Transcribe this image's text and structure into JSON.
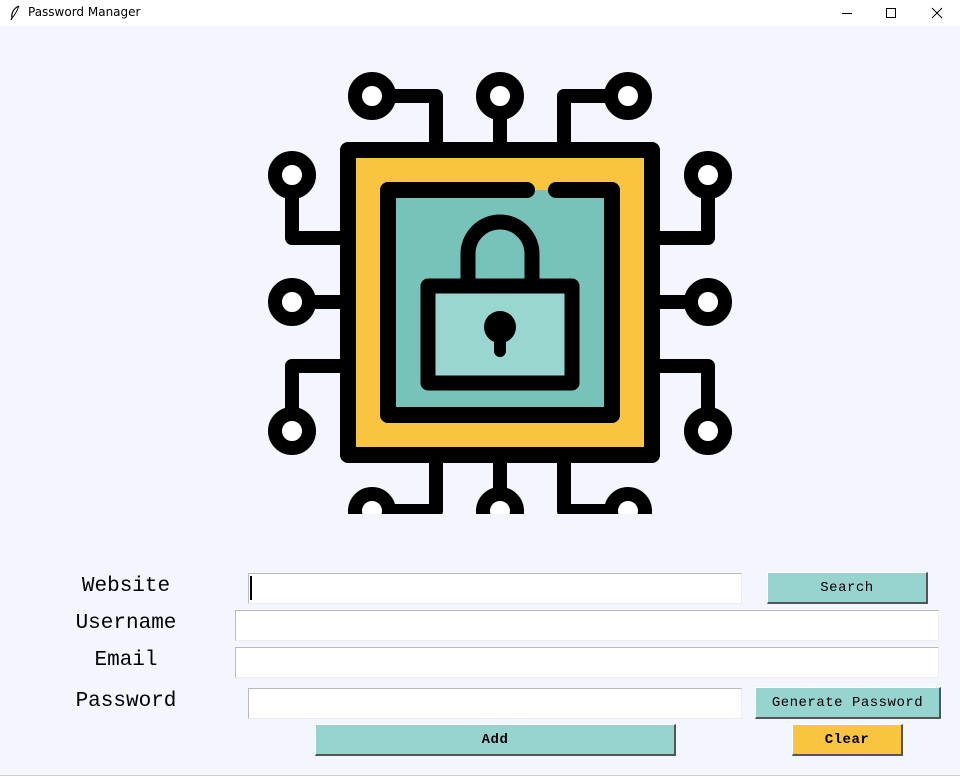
{
  "window": {
    "title": "Password Manager",
    "app_icon": "feather-icon",
    "controls": [
      "minimize-icon",
      "maximize-icon",
      "close-icon"
    ]
  },
  "logo": {
    "icon": "lock-chip-icon",
    "colors": {
      "outline": "#000000",
      "outer": "#f9c440",
      "inner": "#77c2b9",
      "lock_body": "#9ad6d0"
    }
  },
  "form": {
    "website_label": "Website",
    "username_label": "Username",
    "email_label": "Email",
    "password_label": "Password",
    "website_value": "",
    "username_value": "",
    "email_value": "",
    "password_value": ""
  },
  "buttons": {
    "search": "Search",
    "generate": "Generate Password",
    "add": "Add",
    "clear": "Clear"
  },
  "colors": {
    "background": "#f3f6ff",
    "teal_button": "#98d4cf",
    "yellow_button": "#f9c440"
  }
}
